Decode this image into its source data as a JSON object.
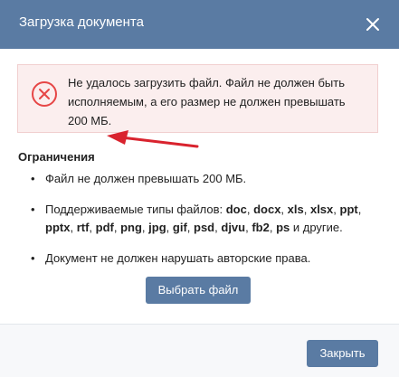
{
  "dialog": {
    "title": "Загрузка документа",
    "close_icon": "close-icon"
  },
  "error": {
    "icon": "error-circle-x-icon",
    "message": "Не удалось загрузить файл. Файл не должен быть исполняемым, а его размер не должен превышать 200 МБ."
  },
  "restrictions": {
    "title": "Ограничения",
    "item1": "Файл не должен превышать 200 МБ.",
    "item2_prefix": "Поддерживаемые типы файлов: ",
    "types": [
      "doc",
      "docx",
      "xls",
      "xlsx",
      "ppt",
      "pptx",
      "rtf",
      "pdf",
      "png",
      "jpg",
      "gif",
      "psd",
      "djvu",
      "fb2",
      "ps"
    ],
    "item2_suffix": " и другие.",
    "item3": "Документ не должен нарушать авторские права."
  },
  "buttons": {
    "choose_file": "Выбрать файл",
    "close": "Закрыть"
  },
  "colors": {
    "header": "#5a7ba3",
    "error_bg": "#fbeeee",
    "error_border": "#f1cfcf",
    "error_icon": "#e64646",
    "arrow": "#d9232e",
    "button": "#5a7ba3"
  }
}
